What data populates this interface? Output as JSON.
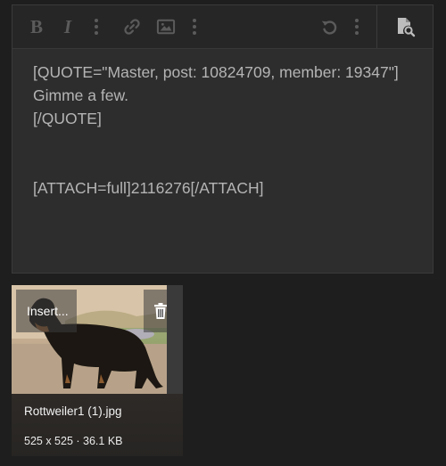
{
  "toolbar": {
    "bold_label": "B",
    "italic_label": "I",
    "buttons": [
      "bold-icon",
      "italic-icon",
      "more-options-icon",
      "link-icon",
      "image-icon",
      "more-options-icon",
      "undo-icon",
      "more-options-icon",
      "preview-icon"
    ]
  },
  "editor": {
    "lines": [
      "[QUOTE=\"Master, post: 10824709, member: 19347\"]",
      "Gimme a few.",
      "[/QUOTE]",
      "",
      "",
      "[ATTACH=full]2116276[/ATTACH]"
    ]
  },
  "attachment": {
    "insert_label": "Insert...",
    "file_name": "Rottweiler1 (1).jpg",
    "meta": "525 x 525 · 36.1 KB"
  },
  "colors": {
    "background": "#1e1e1e",
    "editor_bg": "#2d2d2d",
    "toolbar_bg": "#262626",
    "text": "#b4b4b4",
    "icon_muted": "#5b5b5b"
  }
}
